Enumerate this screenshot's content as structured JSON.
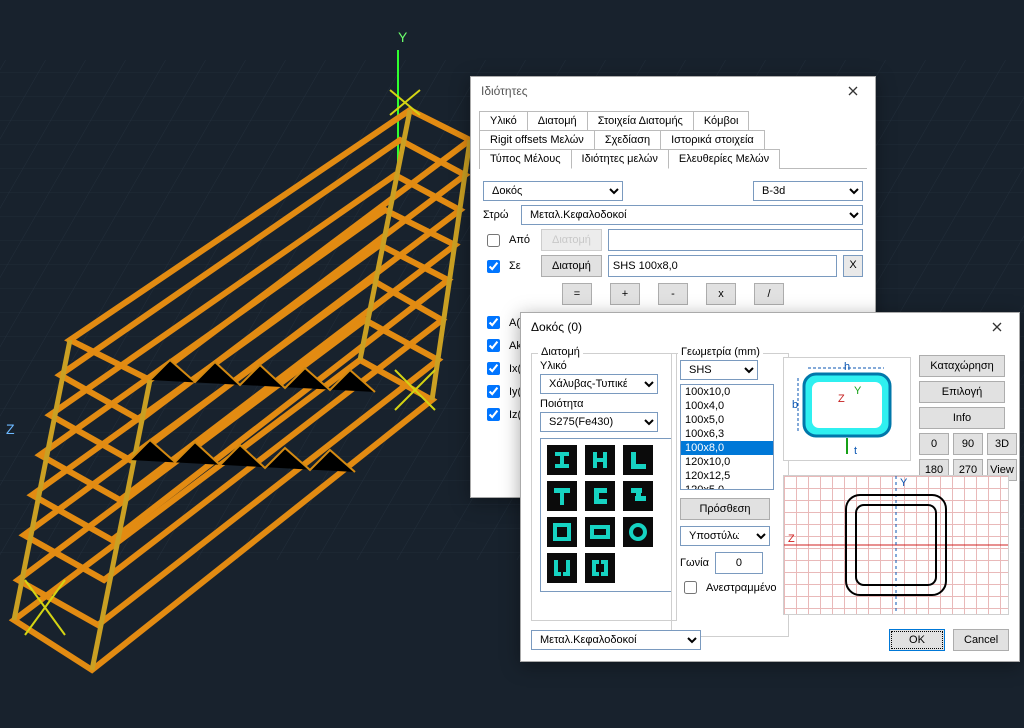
{
  "viewport": {
    "axis_y": "Y",
    "axis_z": "Z"
  },
  "win1": {
    "title": "Ιδιότητες",
    "tabs_row1": [
      "Υλικό",
      "Διατομή",
      "Στοιχεία Διατομής",
      "Κόμβοι"
    ],
    "tabs_row2": [
      "Rigit offsets Μελών",
      "Σχεδίαση",
      "Ιστορικά στοιχεία"
    ],
    "tabs_row3": [
      "Τύπος Μέλους",
      "Ιδιότητες μελών",
      "Ελευθερίες Μελών"
    ],
    "active_tab": "Ιδιότητες μελών",
    "type_select": "Δοκός",
    "code_select": "B-3d",
    "layer_label": "Στρώ",
    "layer_value": "Μεταλ.Κεφαλοδοκοί",
    "from_label": "Από",
    "to_label": "Σε",
    "section_btn": "Διατομή",
    "to_section_value": "SHS 100x8,0",
    "ops": [
      "=",
      "+",
      "-",
      "x",
      "/"
    ],
    "props": [
      {
        "k": "A(i",
        "lbl": "A(i"
      },
      {
        "k": "Ak",
        "lbl": "Ak"
      },
      {
        "k": "Ix",
        "lbl": "Ix("
      },
      {
        "k": "Iy",
        "lbl": "Iy(i"
      },
      {
        "k": "Iz",
        "lbl": "Iz("
      }
    ]
  },
  "win2": {
    "title": "Δοκός (0)",
    "group_section": "Διατομή",
    "material_label": "Υλικό",
    "material_value": "Χάλυβας-Τυπικές",
    "quality_label": "Ποιότητα",
    "quality_value": "S275(Fe430)",
    "group_geom": "Γεωμετρία (mm)",
    "geom_family": "SHS",
    "geom_list": [
      "100x10,0",
      "100x4,0",
      "100x5,0",
      "100x6,3",
      "100x8,0",
      "120x10,0",
      "120x12,5",
      "120x5,0"
    ],
    "geom_selected": "100x8,0",
    "add_btn": "Πρόσθεση",
    "column_btn": "Υποστύλωμα",
    "angle_label": "Γωνία",
    "angle_value": "0",
    "flip_label": "Ανεστραμμένο",
    "diagram_h": "h",
    "diagram_b": "b",
    "diagram_z": "Z",
    "diagram_y": "Y",
    "diagram_t": "t",
    "actions": {
      "register": "Καταχώρηση",
      "select": "Επιλογή",
      "info": "Info"
    },
    "orient": [
      "0",
      "90",
      "3D",
      "180",
      "270",
      "View"
    ],
    "layer_value": "Μεταλ.Κεφαλοδοκοί",
    "ok": "OK",
    "cancel": "Cancel",
    "preview_z": "Z",
    "preview_y": "Y"
  }
}
